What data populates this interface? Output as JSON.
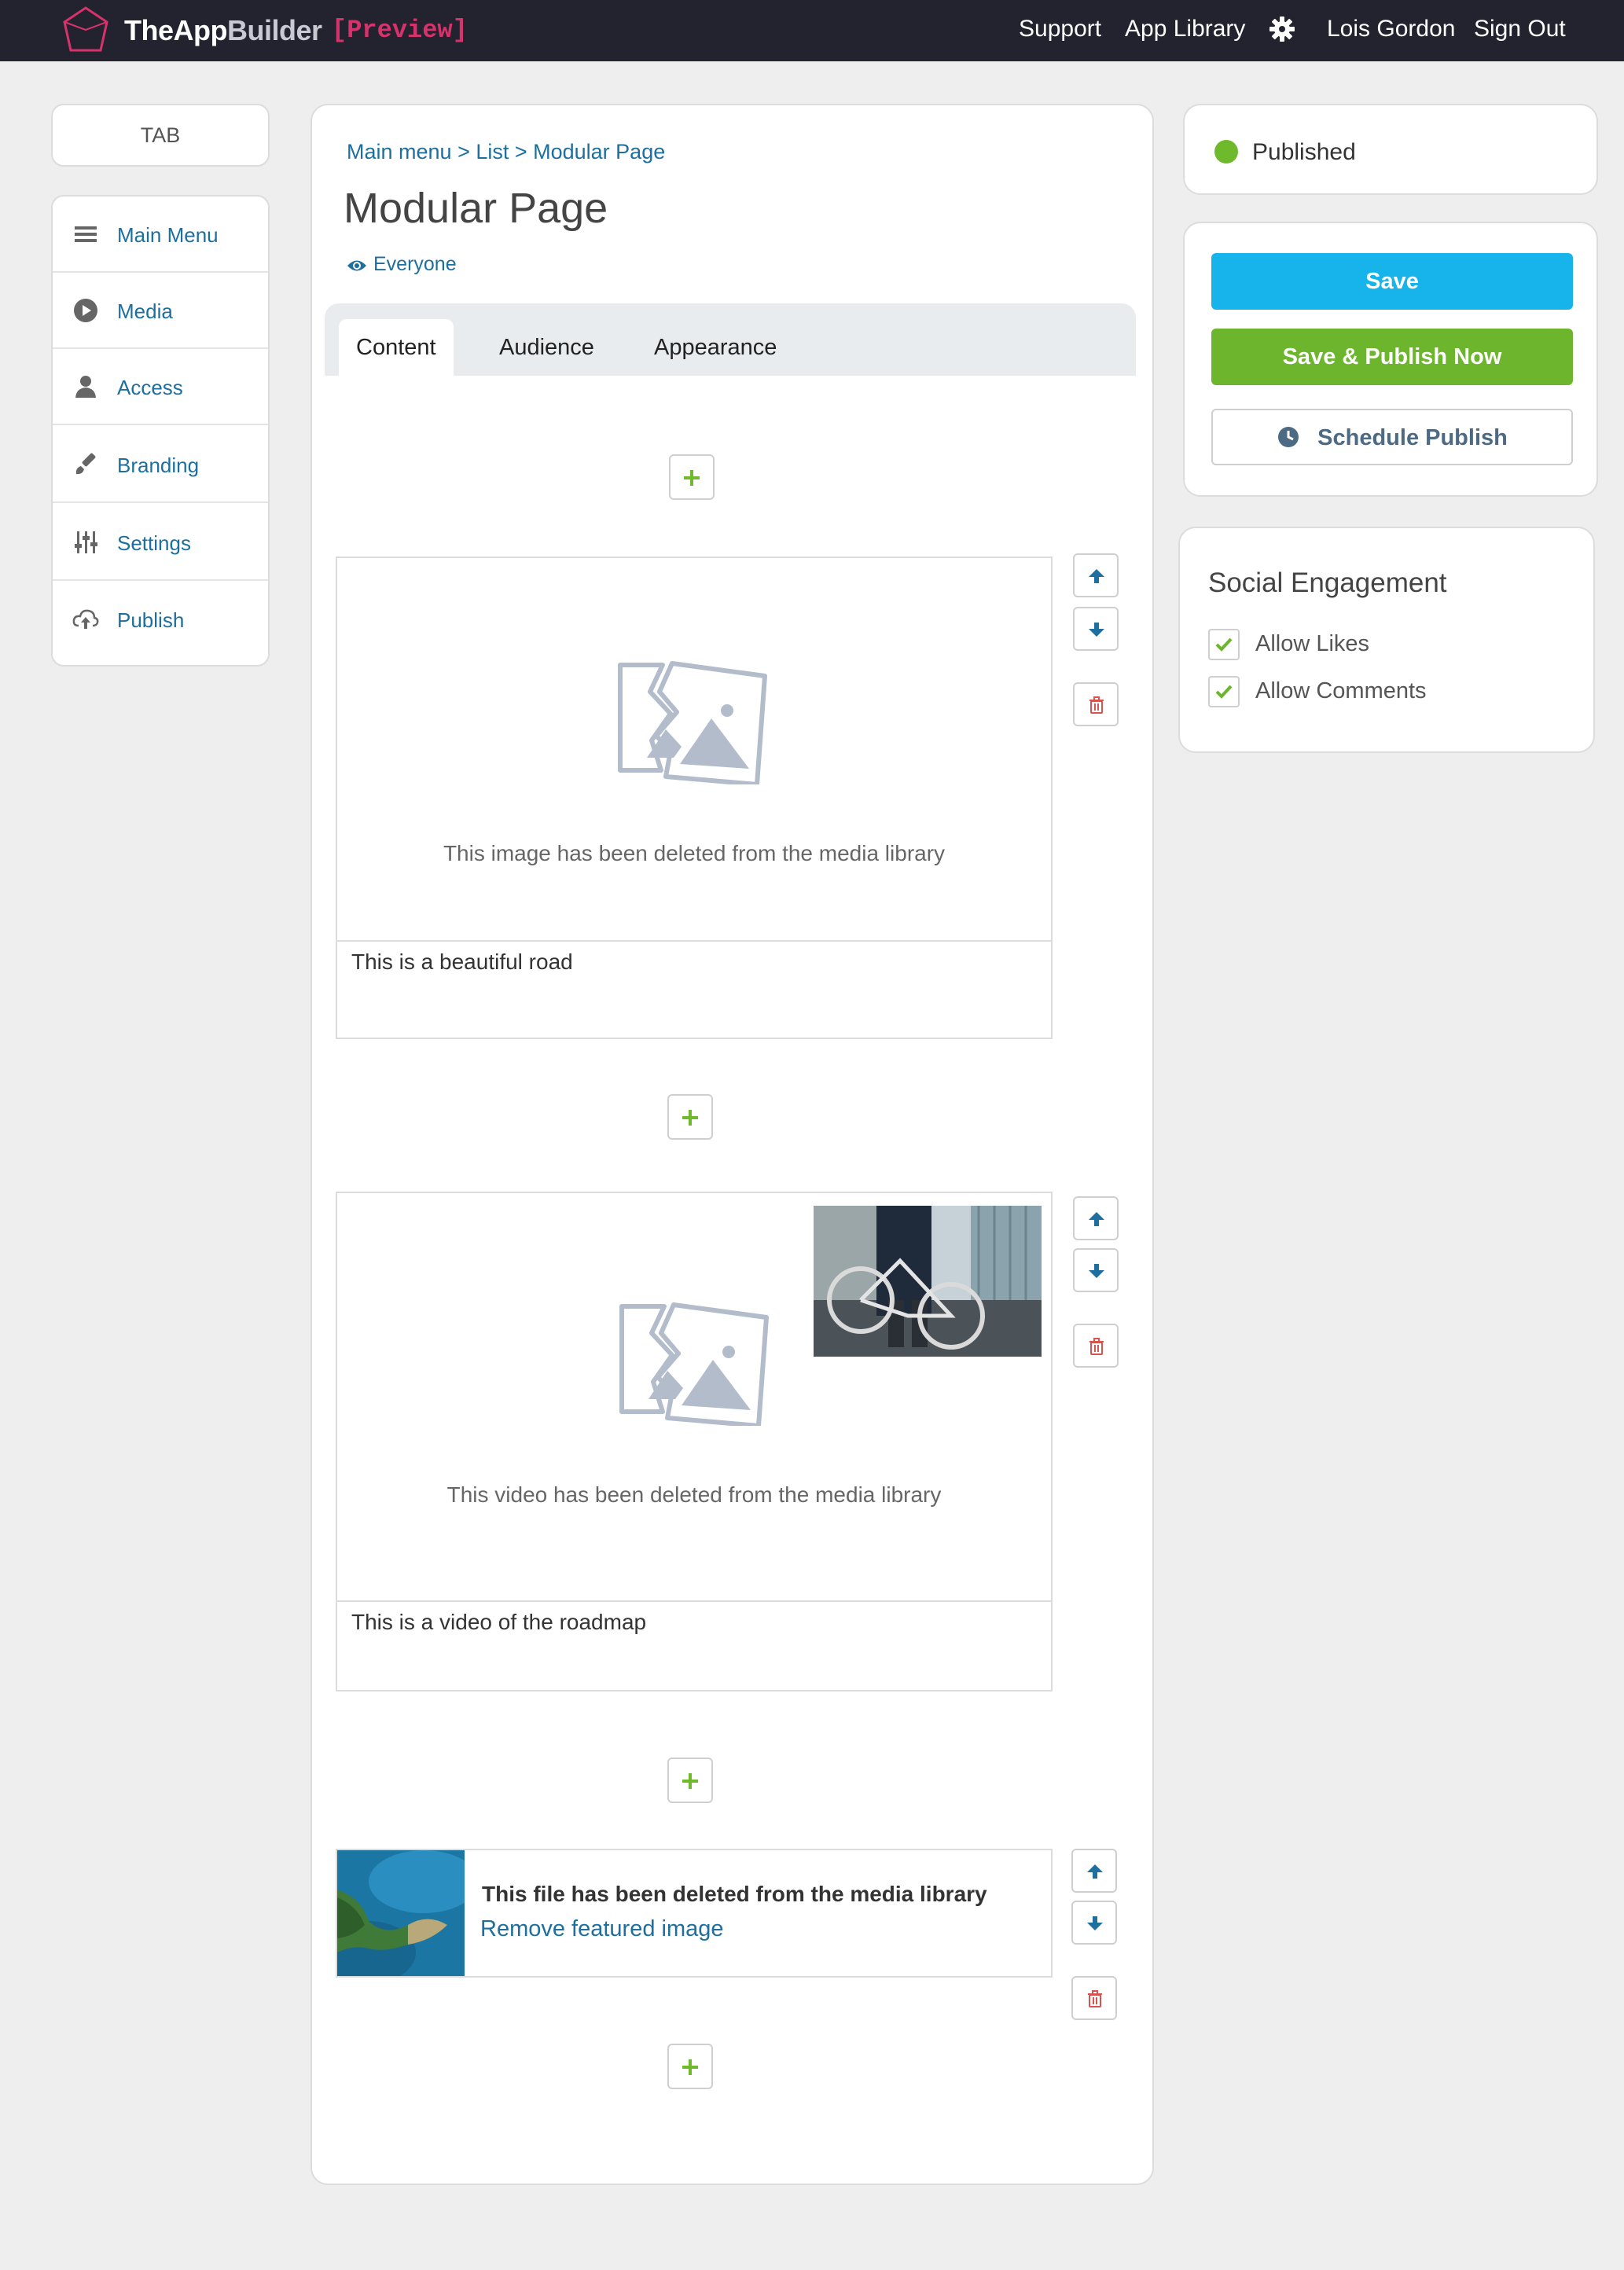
{
  "header": {
    "brand_main": "TheApp",
    "brand_builder": "Builder",
    "preview": "[Preview]",
    "nav": [
      "Support",
      "App Library",
      "Lois Gordon",
      "Sign Out"
    ],
    "icons": [
      "logo-mark",
      "gear-icon"
    ]
  },
  "sidebar": {
    "tab_label": "TAB",
    "items": [
      {
        "label": "Main Menu",
        "icon": "hamburger-icon"
      },
      {
        "label": "Media",
        "icon": "play-icon"
      },
      {
        "label": "Access",
        "icon": "user-icon"
      },
      {
        "label": "Branding",
        "icon": "brush-icon"
      },
      {
        "label": "Settings",
        "icon": "sliders-icon"
      },
      {
        "label": "Publish",
        "icon": "cloud-upload-icon"
      }
    ]
  },
  "main": {
    "breadcrumb": "Main menu > List > Modular Page",
    "title": "Modular Page",
    "audience": "Everyone",
    "tabs": [
      "Content",
      "Audience",
      "Appearance"
    ],
    "active_tab": "Content",
    "blocks": [
      {
        "message": "This image has been deleted from the media library",
        "caption": "This is a beautiful road"
      },
      {
        "message": "This video has been deleted from the media library",
        "caption": "This is a video of the roadmap"
      },
      {
        "message": "This file has been deleted from the media library",
        "link": "Remove featured image"
      }
    ]
  },
  "status": {
    "label": "Published",
    "color": "#6fba2c"
  },
  "actions": {
    "save": "Save",
    "save_publish": "Save & Publish Now",
    "schedule": "Schedule Publish"
  },
  "social": {
    "title": "Social Engagement",
    "options": [
      {
        "label": "Allow Likes",
        "checked": true
      },
      {
        "label": "Allow Comments",
        "checked": true
      }
    ]
  },
  "colors": {
    "accent_blue": "#16b4ea",
    "accent_green": "#6cb52d",
    "link": "#1d6f9f",
    "danger": "#d9534f"
  }
}
